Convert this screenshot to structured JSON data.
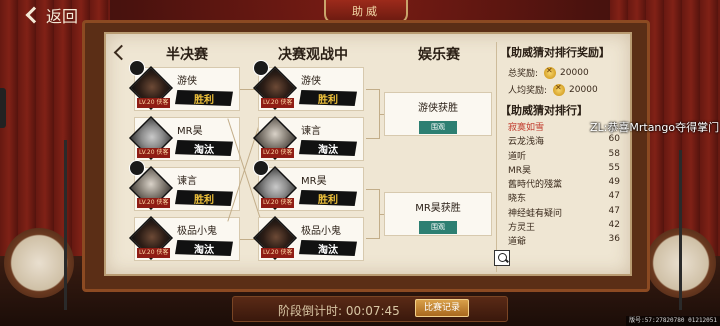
{
  "top": {
    "back_label": "返回",
    "title": "助威"
  },
  "columns": {
    "semifinal": "半决赛",
    "final_watching": "决赛观战中",
    "entertainment": "娱乐赛"
  },
  "semifinal_players": [
    {
      "name": "游侠",
      "result": "胜利",
      "badge": "LV.20 侠客"
    },
    {
      "name": "MR昊",
      "result": "淘汰",
      "badge": "LV.20 侠客"
    },
    {
      "name": "谏言",
      "result": "胜利",
      "badge": "LV.20 侠客"
    },
    {
      "name": "极品小鬼",
      "result": "淘汰",
      "badge": "LV.20 侠客"
    }
  ],
  "final_players": [
    {
      "name": "游侠",
      "result": "胜利",
      "badge": "LV.20 侠客"
    },
    {
      "name": "谏言",
      "result": "淘汰",
      "badge": "LV.20 侠客"
    },
    {
      "name": "MR昊",
      "result": "胜利",
      "badge": "LV.20 侠客"
    },
    {
      "name": "极品小鬼",
      "result": "淘汰",
      "badge": "LV.20 侠客"
    }
  ],
  "entertainment_results": [
    {
      "text": "游侠获胜",
      "button": "围观"
    },
    {
      "text": "MR昊获胜",
      "button": "围观"
    }
  ],
  "rank_panel": {
    "reward_header": "【助威猜对排行奖励】",
    "total_label": "总奖励:",
    "total_value": "20000",
    "per_label": "人均奖励:",
    "per_value": "20000",
    "rank_header": "【助威猜对排行】",
    "items": [
      {
        "name": "寂寞如雪",
        "score": ""
      },
      {
        "name": "云龙浅海",
        "score": "60"
      },
      {
        "name": "道听",
        "score": "58"
      },
      {
        "name": "MR昊",
        "score": "55"
      },
      {
        "name": "舊時代的殘黨",
        "score": "49"
      },
      {
        "name": "晓东",
        "score": "47"
      },
      {
        "name": "神经蛙有疑问",
        "score": "47"
      },
      {
        "name": "方灵王",
        "score": "42"
      },
      {
        "name": "道爺",
        "score": "36"
      }
    ]
  },
  "marquee": "ZL:恭喜Mrtango夺得掌门",
  "bottom": {
    "countdown_label": "阶段倒计时:",
    "countdown_value": "00:07:45",
    "record_button": "比赛记录"
  },
  "footer_id": "版号:57:27820780 01212051",
  "colors": {
    "win": "#f0c23b",
    "lose": "#ffffff",
    "watch_button": "#2d7f72",
    "rank_top": "#c0392b"
  },
  "icons": [
    "back-chevron-icon",
    "coin-icon",
    "zoom-icon",
    "nav-left-chevron-icon"
  ]
}
